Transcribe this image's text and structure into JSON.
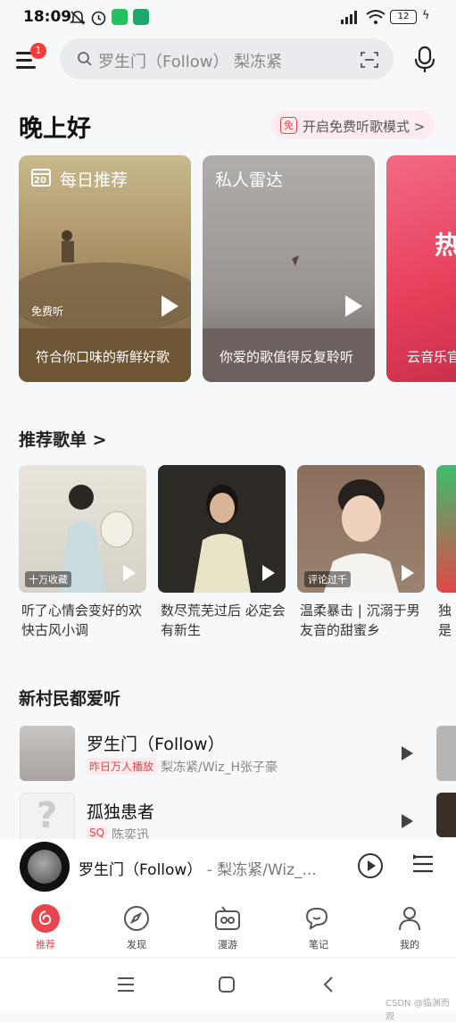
{
  "status_bar": {
    "time": "18:09",
    "battery": "12"
  },
  "header": {
    "notification_count": "1",
    "search_placeholder": "罗生门（Follow） 梨冻紧"
  },
  "greeting": {
    "title": "晚上好",
    "free_mode_icon": "免",
    "free_mode_label": "开启免费听歌模式 >"
  },
  "feature_cards": [
    {
      "title": "每日推荐",
      "calendar_day": "20",
      "badge": "免费听",
      "subtitle": "符合你口味的新鲜好歌"
    },
    {
      "title": "私人雷达",
      "subtitle": "你爱的歌值得反复聆听"
    },
    {
      "title": "热",
      "subtitle": "云音乐官"
    }
  ],
  "recommended_playlists": {
    "heading": "推荐歌单 >",
    "items": [
      {
        "tag": "十万收藏",
        "title": "听了心情会变好的欢快古风小调"
      },
      {
        "tag": "",
        "title": "数尽荒芜过后 必定会有新生"
      },
      {
        "tag": "评论过千",
        "title": "温柔暴击 | 沉溺于男友音的甜蜜乡"
      },
      {
        "tag": "",
        "title": "独是"
      }
    ]
  },
  "village_section": {
    "heading": "新村民都爱听",
    "songs": [
      {
        "title": "罗生门（Follow）",
        "tag": "昨日万人播放",
        "artist": "梨冻紧/Wiz_H张子豪"
      },
      {
        "title": "孤独患者",
        "tag": "SQ",
        "artist": "陈奕迅"
      }
    ]
  },
  "mini_player": {
    "title": "罗生门（Follow）",
    "artist": " - 梨冻紧/Wiz_..."
  },
  "bottom_nav": [
    {
      "label": "推荐",
      "icon": "netease-logo-icon"
    },
    {
      "label": "发现",
      "icon": "compass-icon"
    },
    {
      "label": "漫游",
      "icon": "radio-icon"
    },
    {
      "label": "笔记",
      "icon": "chat-icon"
    },
    {
      "label": "我的",
      "icon": "profile-icon"
    }
  ],
  "watermark": "CSDN @临渊而观",
  "colors": {
    "accent": "#e8454f",
    "background": "#f7f8fa"
  }
}
